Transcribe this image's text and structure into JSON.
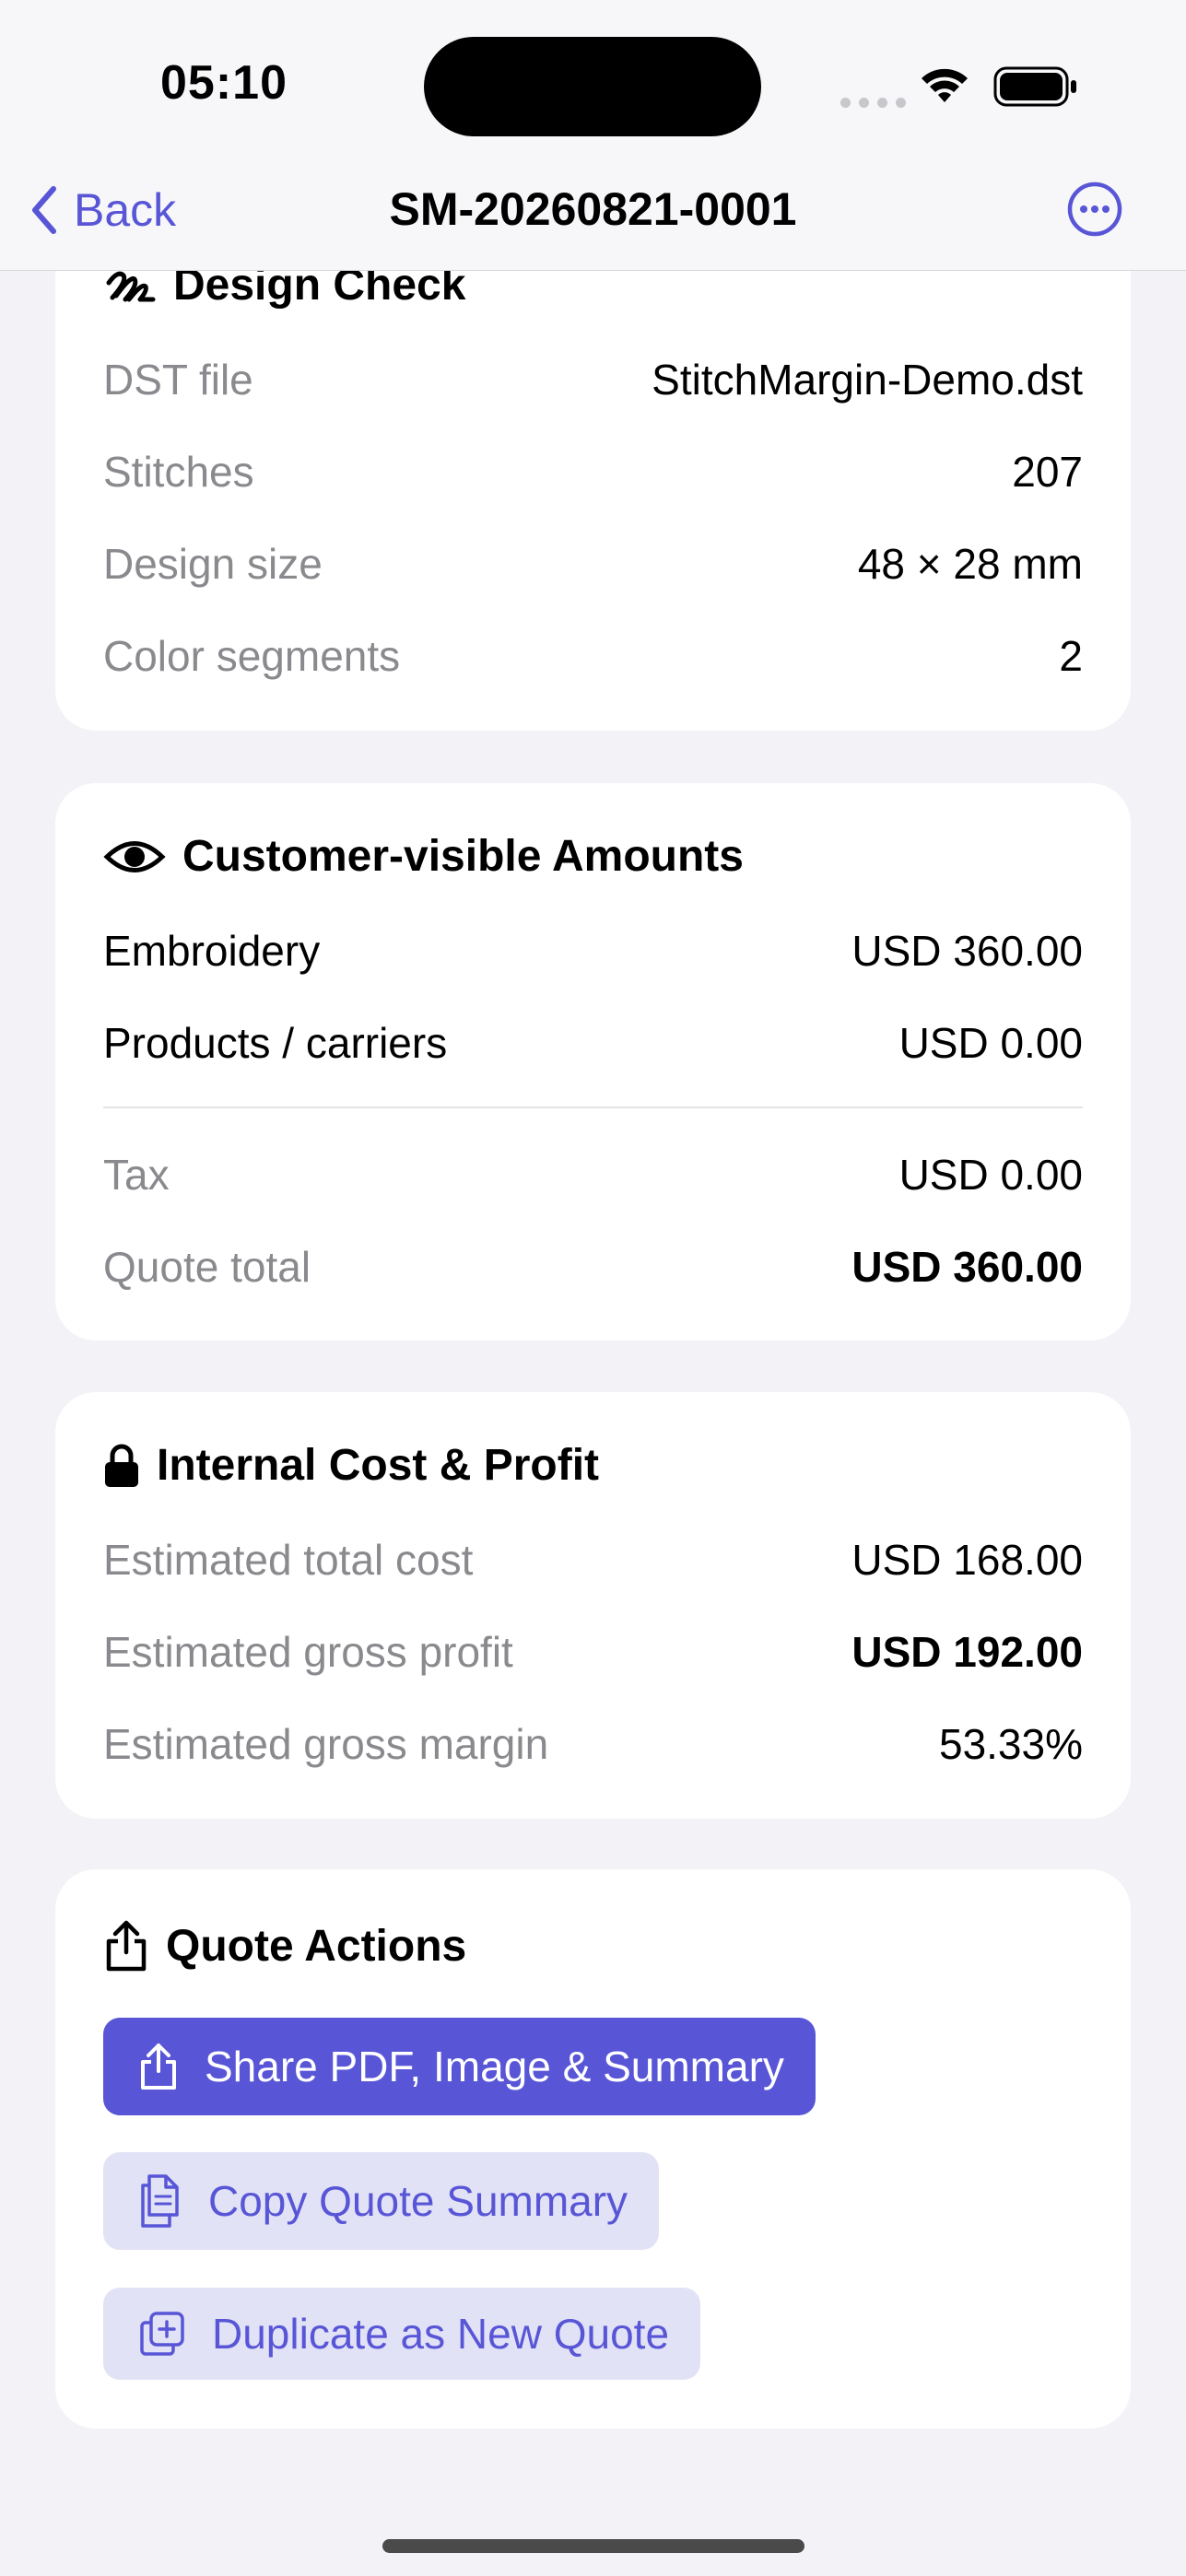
{
  "status_bar": {
    "time": "05:10"
  },
  "nav": {
    "back_label": "Back",
    "title": "SM-20260821-0001"
  },
  "design_check": {
    "title": "Design Check",
    "rows": [
      {
        "label": "DST file",
        "value": "StitchMargin-Demo.dst"
      },
      {
        "label": "Stitches",
        "value": "207"
      },
      {
        "label": "Design size",
        "value": "48 × 28 mm"
      },
      {
        "label": "Color segments",
        "value": "2"
      }
    ]
  },
  "customer_amounts": {
    "title": "Customer-visible Amounts",
    "rows": [
      {
        "label": "Embroidery",
        "value": "USD 360.00"
      },
      {
        "label": "Products / carriers",
        "value": "USD 0.00"
      },
      {
        "label": "Tax",
        "value": "USD 0.00"
      },
      {
        "label": "Quote total",
        "value": "USD 360.00"
      }
    ]
  },
  "internal_cost": {
    "title": "Internal Cost & Profit",
    "rows": [
      {
        "label": "Estimated total cost",
        "value": "USD 168.00"
      },
      {
        "label": "Estimated gross profit",
        "value": "USD 192.00"
      },
      {
        "label": "Estimated gross margin",
        "value": "53.33%"
      }
    ]
  },
  "quote_actions": {
    "title": "Quote Actions",
    "share_label": "Share PDF, Image & Summary",
    "copy_label": "Copy Quote Summary",
    "duplicate_label": "Duplicate as New Quote"
  },
  "colors": {
    "accent": "#5856D6",
    "accent_light": "#E2E2F6",
    "background": "#F2F2F7"
  }
}
